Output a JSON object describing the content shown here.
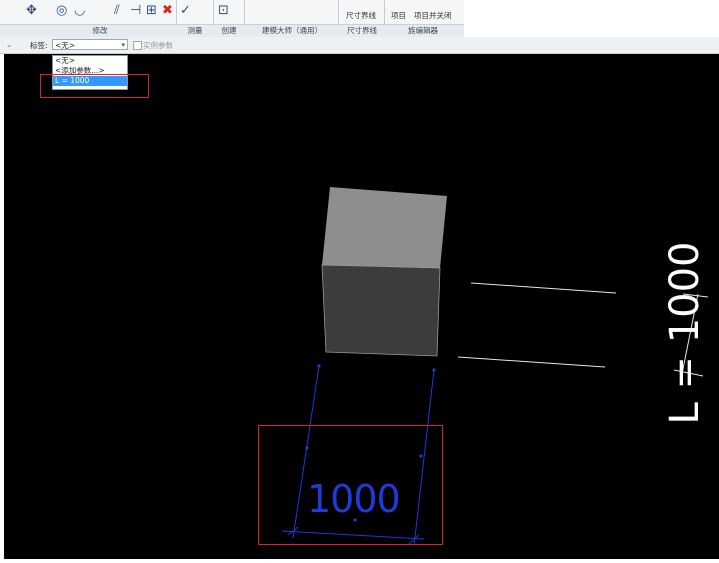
{
  "ribbon": {
    "panels": [
      {
        "label": "修改"
      },
      {
        "label": "测量"
      },
      {
        "label": "创建"
      },
      {
        "label": "建模大师（通用）"
      },
      {
        "label": "尺寸界线"
      },
      {
        "label": "族编辑器"
      }
    ],
    "right_labels": [
      "尺寸界线",
      "项目",
      "项目并关闭"
    ],
    "delete_icon_color": "#d7261e"
  },
  "options_bar": {
    "tag_label": "标签:",
    "selected_value": "<无>",
    "instance_param_label": "实例参数"
  },
  "label_dropdown": {
    "items": [
      "<无>",
      "<添加参数...>",
      "L = 1000"
    ],
    "selected_index": 2
  },
  "canvas": {
    "background": "#000000",
    "dimension_value": "1000",
    "parameter_label": "L = 1000"
  },
  "highlight_color": "#d9241f"
}
